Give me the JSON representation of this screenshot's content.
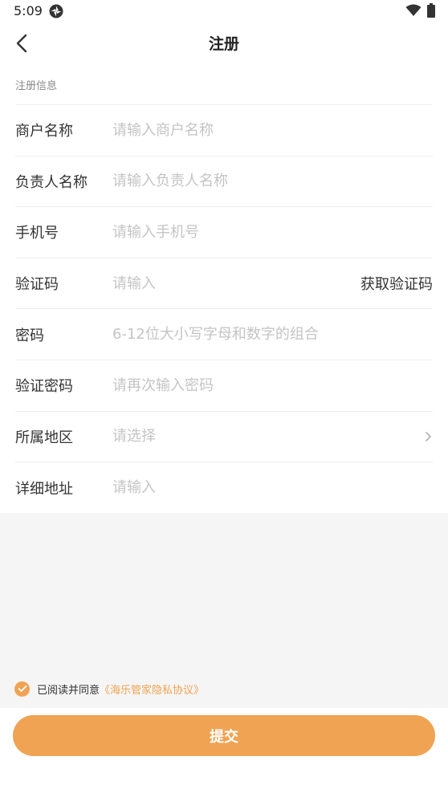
{
  "status_bar": {
    "time": "5:09"
  },
  "nav": {
    "title": "注册"
  },
  "section": {
    "title": "注册信息"
  },
  "form": {
    "merchant_name": {
      "label": "商户名称",
      "placeholder": "请输入商户名称"
    },
    "contact_name": {
      "label": "负责人名称",
      "placeholder": "请输入负责人名称"
    },
    "phone": {
      "label": "手机号",
      "placeholder": "请输入手机号"
    },
    "code": {
      "label": "验证码",
      "placeholder": "请输入",
      "action": "获取验证码"
    },
    "password": {
      "label": "密码",
      "placeholder": "6-12位大小写字母和数字的组合"
    },
    "confirm_password": {
      "label": "验证密码",
      "placeholder": "请再次输入密码"
    },
    "region": {
      "label": "所属地区",
      "placeholder": "请选择"
    },
    "address": {
      "label": "详细地址",
      "placeholder": "请输入"
    }
  },
  "agreement": {
    "checked": true,
    "text": "已阅读并同意",
    "link": "《海乐管家隐私协议》"
  },
  "submit": {
    "label": "提交"
  },
  "colors": {
    "accent": "#f0a352",
    "placeholder": "#c4c4c4",
    "divider": "#eeeeee",
    "background_gray": "#f5f5f5"
  }
}
